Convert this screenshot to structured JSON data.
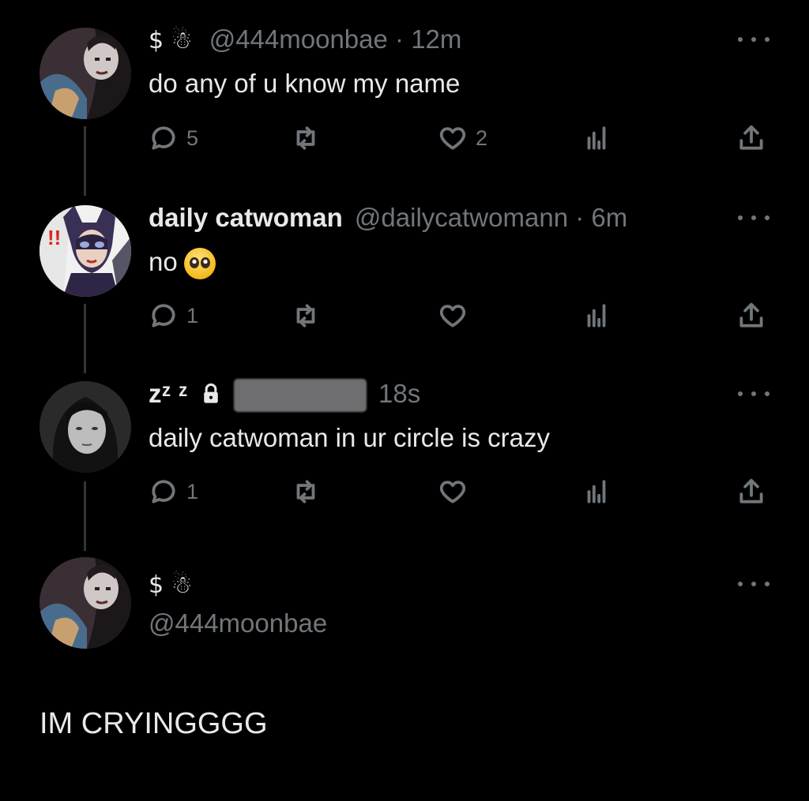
{
  "posts": [
    {
      "symbols": "$ ☃",
      "name": "",
      "handle": "@444moonbae",
      "time": "· 12m",
      "text": "do any of u know my name",
      "reply_count": "5",
      "like_count": "2",
      "avatar": "avatar-woman-with-face-paint"
    },
    {
      "name": "daily catwoman",
      "handle": "@dailycatwomann",
      "time": "· 6m",
      "text": "no",
      "emoji": "pleading-face",
      "reply_count": "1",
      "like_count": "",
      "avatar": "avatar-catwoman-comic"
    },
    {
      "symbols": "zᶻ ᶻ",
      "handle": "",
      "time": "18s",
      "text": "daily catwoman in ur circle is crazy",
      "reply_count": "1",
      "like_count": "",
      "avatar": "avatar-woman-photo"
    }
  ],
  "main_post": {
    "symbols": "$ ☃",
    "handle": "@444moonbae",
    "avatar": "avatar-woman-with-face-paint"
  },
  "caption": "IM CRYINGGGG",
  "colors": {
    "background": "#000000",
    "text": "#e7e9ea",
    "muted": "#71767b",
    "thread_line": "#333639"
  }
}
